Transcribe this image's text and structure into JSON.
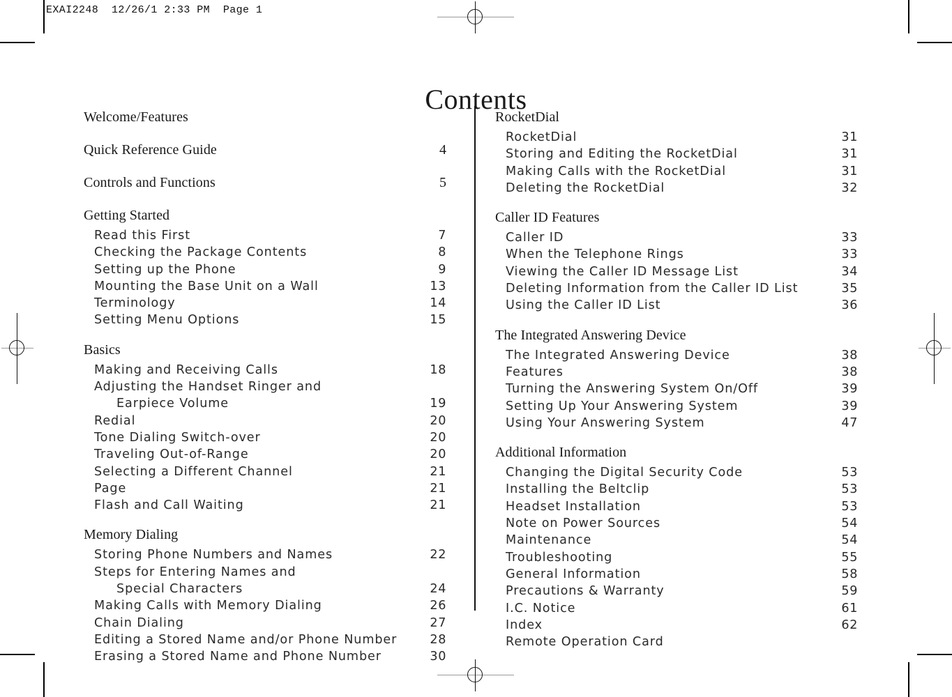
{
  "slug": "EXAI2248  12/26/1 2:33 PM  Page 1",
  "title": "Contents",
  "columns": {
    "left": [
      {
        "heading": "Welcome/Features",
        "heading_page": "",
        "entries": []
      },
      {
        "heading": "Quick Reference Guide",
        "heading_page": "4",
        "entries": []
      },
      {
        "heading": "Controls and Functions",
        "heading_page": "5",
        "entries": []
      },
      {
        "heading": "Getting Started",
        "heading_page": "",
        "entries": [
          {
            "label": "Read this First",
            "page": "7",
            "cont": false
          },
          {
            "label": "Checking the Package Contents",
            "page": "8",
            "cont": false
          },
          {
            "label": "Setting up the Phone",
            "page": "9",
            "cont": false
          },
          {
            "label": "Mounting the Base Unit on a Wall",
            "page": "13",
            "cont": false
          },
          {
            "label": "Terminology",
            "page": "14",
            "cont": false
          },
          {
            "label": "Setting Menu Options",
            "page": "15",
            "cont": false
          }
        ]
      },
      {
        "heading": "Basics",
        "heading_page": "",
        "entries": [
          {
            "label": "Making and Receiving Calls",
            "page": "18",
            "cont": false
          },
          {
            "label": "Adjusting the Handset Ringer and",
            "page": "",
            "cont": false
          },
          {
            "label": "Earpiece Volume",
            "page": "19",
            "cont": true
          },
          {
            "label": "Redial",
            "page": "20",
            "cont": false
          },
          {
            "label": "Tone Dialing Switch-over",
            "page": "20",
            "cont": false
          },
          {
            "label": "Traveling Out-of-Range",
            "page": "20",
            "cont": false
          },
          {
            "label": "Selecting a Different Channel",
            "page": "21",
            "cont": false
          },
          {
            "label": "Page",
            "page": "21",
            "cont": false
          },
          {
            "label": "Flash and Call Waiting",
            "page": "21",
            "cont": false
          }
        ]
      },
      {
        "heading": "Memory Dialing",
        "heading_page": "",
        "entries": [
          {
            "label": "Storing Phone Numbers and Names",
            "page": "22",
            "cont": false
          },
          {
            "label": "Steps for Entering Names and",
            "page": "",
            "cont": false
          },
          {
            "label": "Special Characters",
            "page": "24",
            "cont": true
          },
          {
            "label": "Making Calls with Memory Dialing",
            "page": "26",
            "cont": false
          },
          {
            "label": "Chain Dialing",
            "page": "27",
            "cont": false
          },
          {
            "label": "Editing a Stored Name and/or Phone Number",
            "page": "28",
            "cont": false
          },
          {
            "label": "Erasing a Stored Name and Phone Number",
            "page": "30",
            "cont": false
          }
        ]
      }
    ],
    "right": [
      {
        "heading": "RocketDial",
        "heading_page": "",
        "entries": [
          {
            "label": "RocketDial",
            "page": "31",
            "cont": false
          },
          {
            "label": "Storing and Editing the RocketDial",
            "page": "31",
            "cont": false
          },
          {
            "label": "Making Calls with the RocketDial",
            "page": "31",
            "cont": false
          },
          {
            "label": "Deleting the RocketDial",
            "page": "32",
            "cont": false
          }
        ]
      },
      {
        "heading": "Caller ID Features",
        "heading_page": "",
        "entries": [
          {
            "label": "Caller ID",
            "page": "33",
            "cont": false
          },
          {
            "label": "When the Telephone Rings",
            "page": "33",
            "cont": false
          },
          {
            "label": "Viewing the Caller ID Message List",
            "page": "34",
            "cont": false
          },
          {
            "label": "Deleting Information from the Caller ID List",
            "page": "35",
            "cont": false
          },
          {
            "label": "Using the Caller ID List",
            "page": "36",
            "cont": false
          }
        ]
      },
      {
        "heading": "The Integrated Answering Device",
        "heading_page": "",
        "entries": [
          {
            "label": "The Integrated Answering Device",
            "page": "38",
            "cont": false
          },
          {
            "label": "Features",
            "page": "38",
            "cont": false
          },
          {
            "label": "Turning the Answering System On/Off",
            "page": "39",
            "cont": false
          },
          {
            "label": "Setting Up Your Answering System",
            "page": "39",
            "cont": false
          },
          {
            "label": "Using Your Answering System",
            "page": "47",
            "cont": false
          }
        ]
      },
      {
        "heading": "Additional Information",
        "heading_page": "",
        "entries": [
          {
            "label": "Changing the Digital Security Code",
            "page": "53",
            "cont": false
          },
          {
            "label": "Installing the Beltclip",
            "page": "53",
            "cont": false
          },
          {
            "label": "Headset Installation",
            "page": "53",
            "cont": false
          },
          {
            "label": "Note on Power Sources",
            "page": "54",
            "cont": false
          },
          {
            "label": "Maintenance",
            "page": "54",
            "cont": false
          },
          {
            "label": "Troubleshooting",
            "page": "55",
            "cont": false
          },
          {
            "label": "General Information",
            "page": "58",
            "cont": false
          },
          {
            "label": "Precautions & Warranty",
            "page": "59",
            "cont": false
          },
          {
            "label": "I.C. Notice",
            "page": "61",
            "cont": false
          },
          {
            "label": "Index",
            "page": "62",
            "cont": false
          },
          {
            "label": "Remote Operation Card",
            "page": "",
            "cont": false
          }
        ]
      }
    ]
  }
}
